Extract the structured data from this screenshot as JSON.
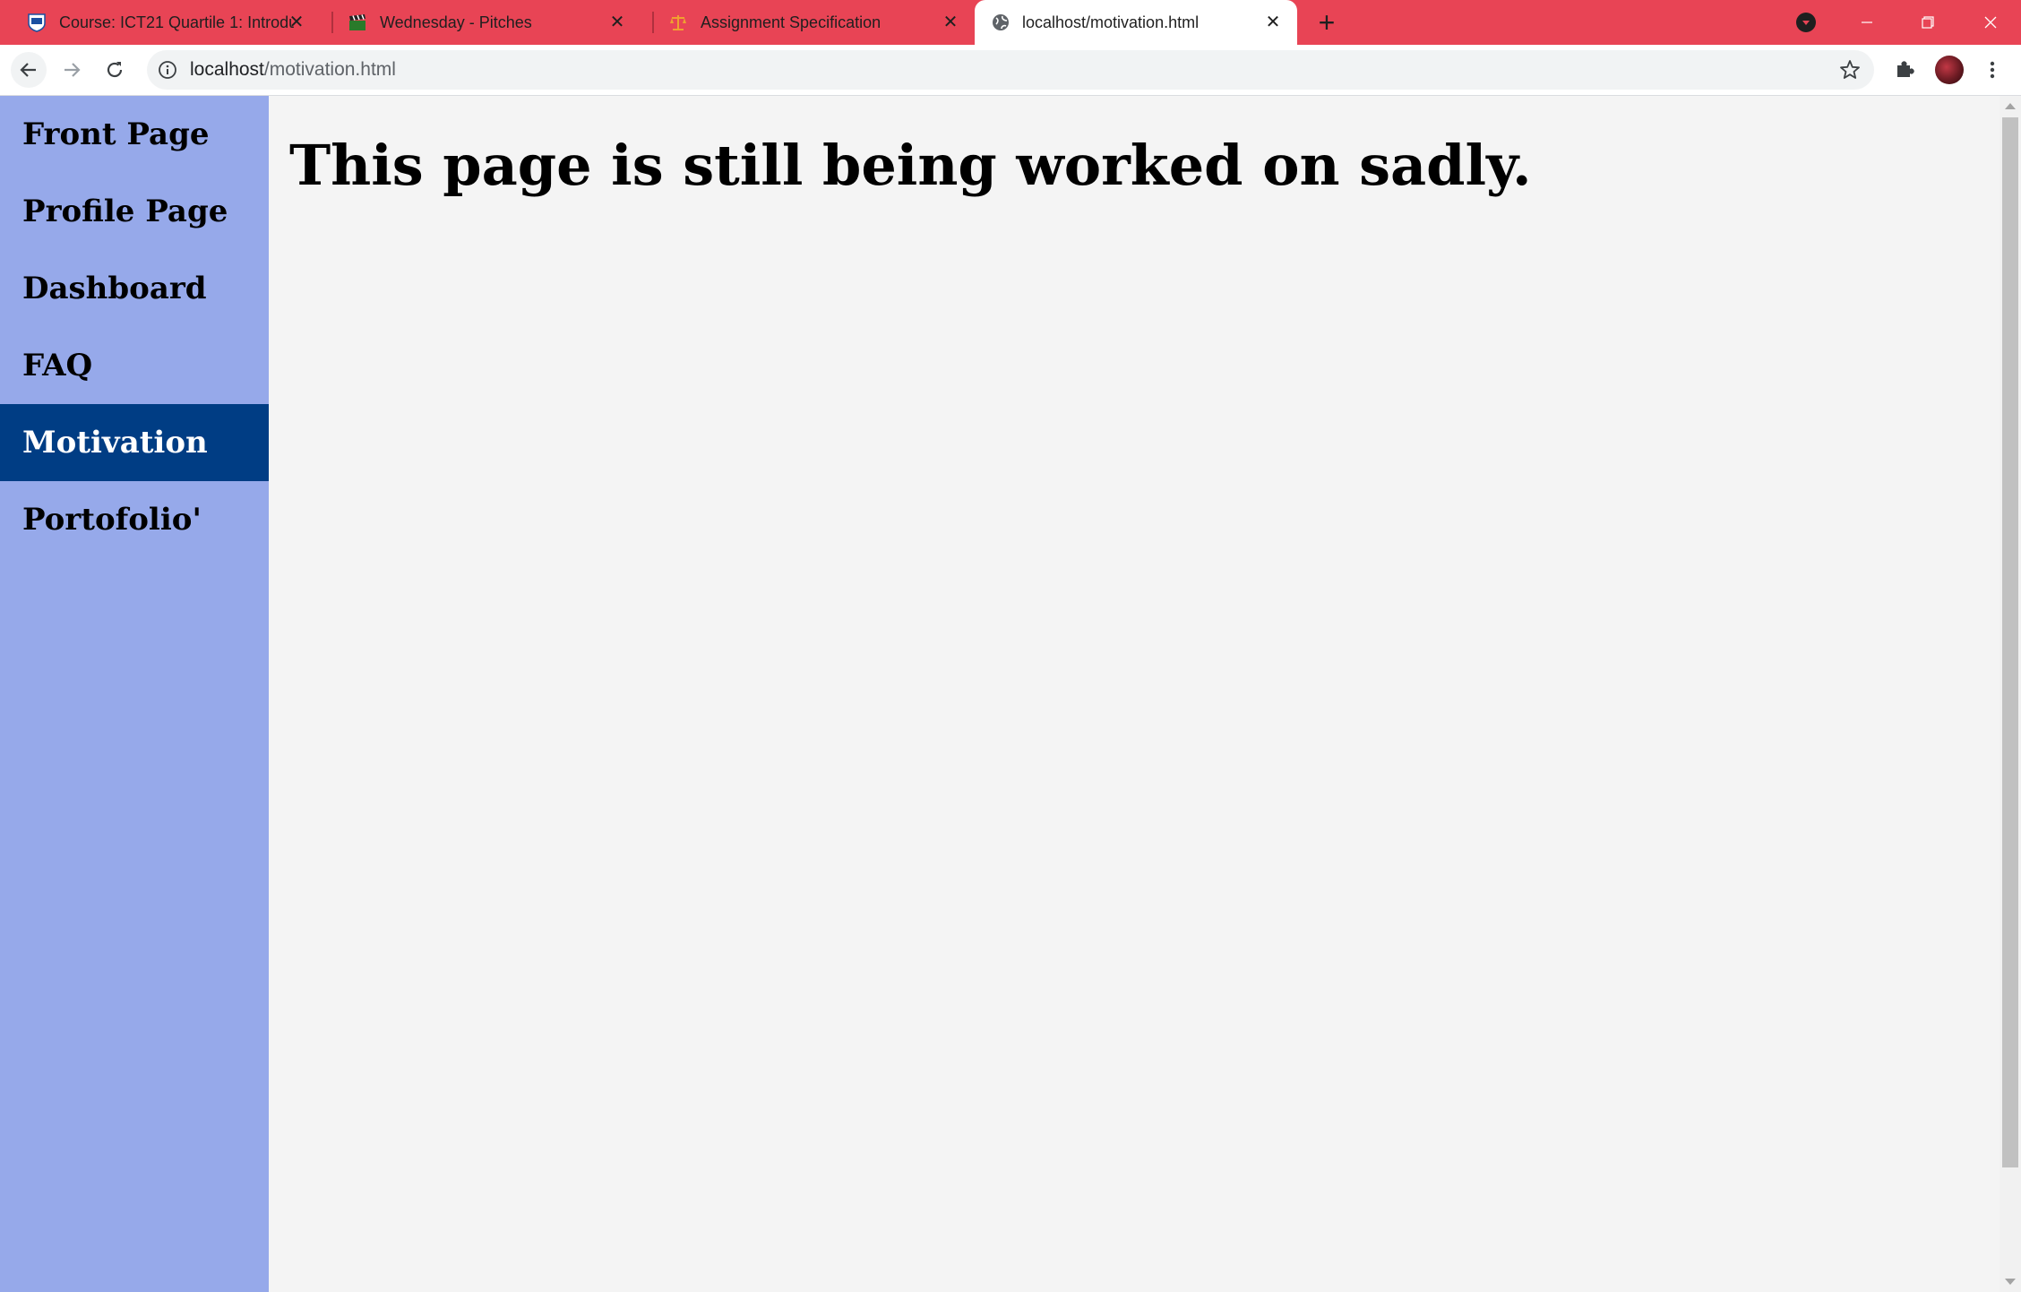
{
  "browser": {
    "tabs": [
      {
        "title": "Course: ICT21 Quartile 1: Introdu",
        "favicon": "hz-shield-icon",
        "active": false
      },
      {
        "title": "Wednesday - Pitches",
        "favicon": "clapperboard-icon",
        "active": false
      },
      {
        "title": "Assignment Specification",
        "favicon": "scales-icon",
        "active": false
      },
      {
        "title": "localhost/motivation.html",
        "favicon": "globe-icon",
        "active": true
      }
    ],
    "address_bar": {
      "host": "localhost",
      "path": "/motivation.html"
    },
    "colors": {
      "tabstrip": "#e84455",
      "active_tab": "#ffffff"
    }
  },
  "sidebar": {
    "items": [
      {
        "label": "Front Page",
        "active": false
      },
      {
        "label": "Profile Page",
        "active": false
      },
      {
        "label": "Dashboard",
        "active": false
      },
      {
        "label": "FAQ",
        "active": false
      },
      {
        "label": "Motivation",
        "active": true
      },
      {
        "label": "Portofolio'",
        "active": false
      }
    ],
    "colors": {
      "background": "#96a9ea",
      "active_background": "#003d84"
    }
  },
  "main": {
    "heading": "This page is still being worked on sadly."
  }
}
